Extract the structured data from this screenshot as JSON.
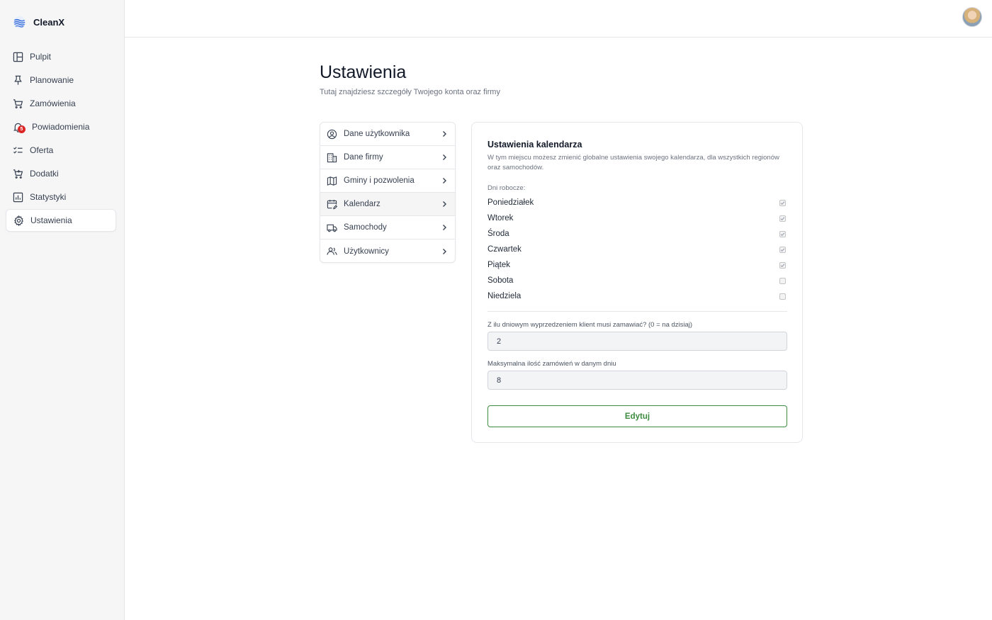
{
  "app": {
    "name": "CleanX"
  },
  "sidebar": {
    "items": [
      {
        "label": "Pulpit",
        "icon": "layout-icon",
        "active": false
      },
      {
        "label": "Planowanie",
        "icon": "pin-icon",
        "active": false
      },
      {
        "label": "Zamówienia",
        "icon": "cart-icon",
        "active": false
      },
      {
        "label": "Powiadomienia",
        "icon": "bell-icon",
        "active": false,
        "badge": "5"
      },
      {
        "label": "Oferta",
        "icon": "checklist-icon",
        "active": false
      },
      {
        "label": "Dodatki",
        "icon": "cart-plus-icon",
        "active": false
      },
      {
        "label": "Statystyki",
        "icon": "chart-icon",
        "active": false
      },
      {
        "label": "Ustawienia",
        "icon": "gear-icon",
        "active": true
      }
    ]
  },
  "page": {
    "title": "Ustawienia",
    "subtitle": "Tutaj znajdziesz szczegóły Twojego konta oraz firmy"
  },
  "settings_menu": {
    "items": [
      {
        "label": "Dane użytkownika",
        "icon": "user-circle-icon",
        "active": false
      },
      {
        "label": "Dane firmy",
        "icon": "building-icon",
        "active": false
      },
      {
        "label": "Gminy i pozwolenia",
        "icon": "map-icon",
        "active": false
      },
      {
        "label": "Kalendarz",
        "icon": "calendar-edit-icon",
        "active": true
      },
      {
        "label": "Samochody",
        "icon": "truck-icon",
        "active": false
      },
      {
        "label": "Użytkownicy",
        "icon": "users-icon",
        "active": false
      }
    ]
  },
  "calendar": {
    "title": "Ustawienia kalendarza",
    "description": "W tym miejscu możesz zmienić globalne ustawienia swojego kalendarza, dla wszystkich regionów oraz samochodów.",
    "days_label": "Dni robocze:",
    "days": [
      {
        "label": "Poniedziałek",
        "checked": true
      },
      {
        "label": "Wtorek",
        "checked": true
      },
      {
        "label": "Środa",
        "checked": true
      },
      {
        "label": "Czwartek",
        "checked": true
      },
      {
        "label": "Piątek",
        "checked": true
      },
      {
        "label": "Sobota",
        "checked": false
      },
      {
        "label": "Niedziela",
        "checked": false
      }
    ],
    "advance_label": "Z ilu dniowym wyprzedzeniem klient musi zamawiać? (0 = na dzisiaj)",
    "advance_value": "2",
    "max_orders_label": "Maksymalna ilość zamówień w danym dniu",
    "max_orders_value": "8",
    "edit_label": "Edytuj"
  },
  "colors": {
    "accent_green": "#3d8b40",
    "badge_red": "#dc2626",
    "brand_blue": "#3b6fd8"
  }
}
